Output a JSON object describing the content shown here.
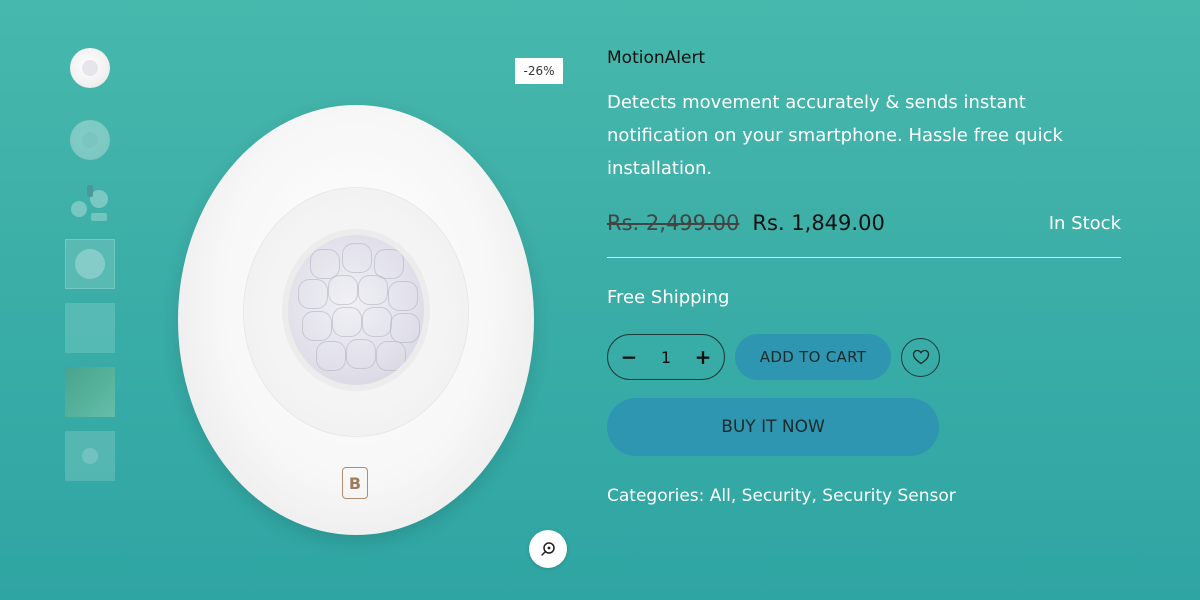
{
  "product": {
    "title": "MotionAlert",
    "description": "Detects movement accurately & sends instant notification on your smartphone. Hassle free quick installation.",
    "old_price": "Rs. 2,499.00",
    "new_price": "Rs. 1,849.00",
    "stock_status": "In Stock",
    "discount_badge": "-26%",
    "shipping": "Free Shipping"
  },
  "purchase": {
    "quantity": "1",
    "minus_symbol": "−",
    "plus_symbol": "+",
    "add_to_cart_label": "ADD TO CART",
    "buy_now_label": "BUY IT NOW"
  },
  "categories": {
    "prefix": "Categories:",
    "items": [
      "All",
      "Security",
      "Security Sensor"
    ]
  },
  "icons": {
    "zoom": "zoom-icon",
    "wishlist": "heart-icon"
  },
  "colors": {
    "background": "#3aada7",
    "button": "#2e96b0"
  }
}
